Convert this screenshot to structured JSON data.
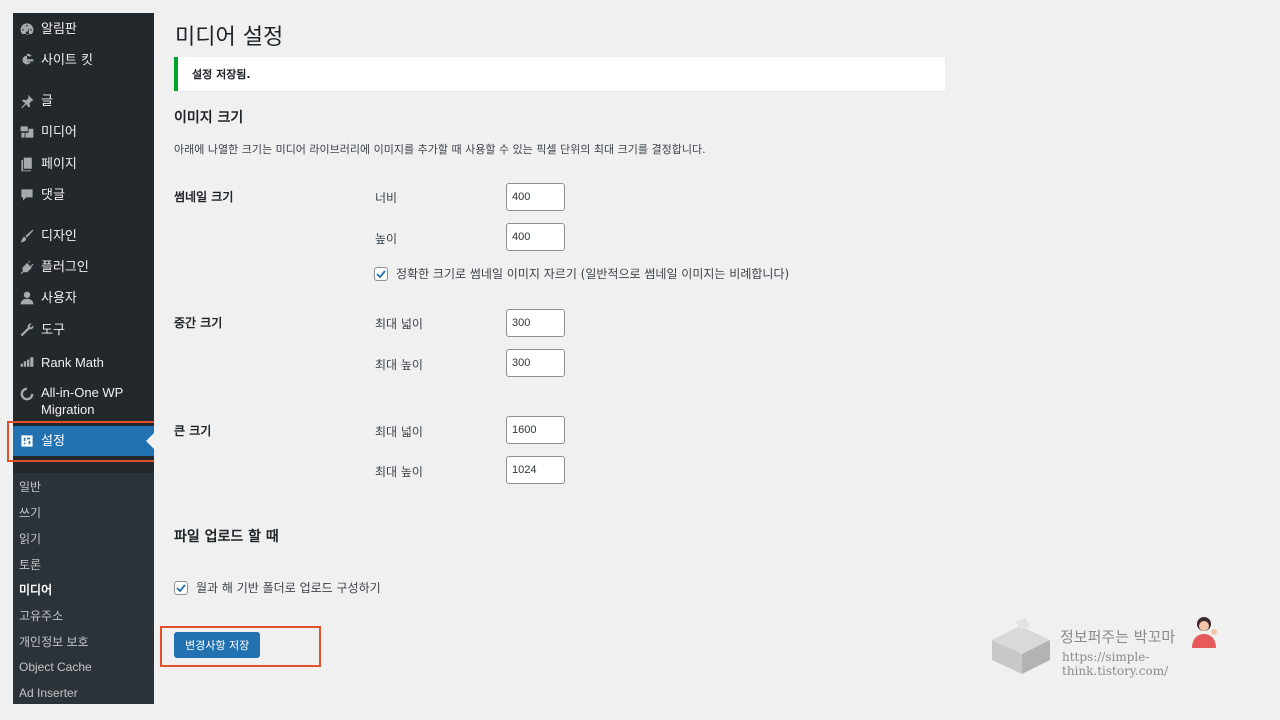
{
  "sidebar": {
    "items": [
      {
        "label": "알림판",
        "icon": "dashboard-icon"
      },
      {
        "label": "사이트 킷",
        "icon": "google-g-icon"
      },
      {
        "label": "글",
        "icon": "pushpin-icon"
      },
      {
        "label": "미디어",
        "icon": "media-icon"
      },
      {
        "label": "페이지",
        "icon": "pages-icon"
      },
      {
        "label": "댓글",
        "icon": "comment-icon"
      },
      {
        "label": "디자인",
        "icon": "brush-icon"
      },
      {
        "label": "플러그인",
        "icon": "plugin-icon"
      },
      {
        "label": "사용자",
        "icon": "user-icon"
      },
      {
        "label": "도구",
        "icon": "wrench-icon"
      },
      {
        "label": "Rank Math",
        "icon": "rankmath-icon"
      },
      {
        "label": "All-in-One WP Migration",
        "icon": "migration-icon"
      },
      {
        "label": "설정",
        "icon": "settings-icon"
      }
    ],
    "submenu": [
      {
        "label": "일반"
      },
      {
        "label": "쓰기"
      },
      {
        "label": "읽기"
      },
      {
        "label": "토론"
      },
      {
        "label": "미디어"
      },
      {
        "label": "고유주소"
      },
      {
        "label": "개인정보 보호"
      },
      {
        "label": "Object Cache"
      },
      {
        "label": "Ad Inserter"
      }
    ]
  },
  "page": {
    "title": "미디어 설정",
    "notice": "설정 저장됨.",
    "image_sizes_heading": "이미지 크기",
    "image_sizes_desc": "아래에 나열한 크기는 미디어 라이브러리에 이미지를 추가할 때 사용할 수 있는 픽셀 단위의 최대 크기를 결정합니다.",
    "thumbnail": {
      "label": "썸네일 크기",
      "width_label": "너비",
      "width_value": "400",
      "height_label": "높이",
      "height_value": "400",
      "crop_label": "정확한 크기로 썸네일 이미지 자르기 (일반적으로 썸네일 이미지는 비례합니다)",
      "crop_checked": true
    },
    "medium": {
      "label": "중간 크기",
      "width_label": "최대 넓이",
      "width_value": "300",
      "height_label": "최대 높이",
      "height_value": "300"
    },
    "large": {
      "label": "큰 크기",
      "width_label": "최대 넓이",
      "width_value": "1600",
      "height_label": "최대 높이",
      "height_value": "1024"
    },
    "uploads_heading": "파일 업로드 할 때",
    "uploads_option_label": "월과 해 기반 폴더로 업로드 구성하기",
    "uploads_option_checked": true,
    "save_label": "변경사항 저장"
  },
  "watermark": {
    "name": "정보퍼주는 박꼬마",
    "url": "https://simple-think.tistory.com/"
  },
  "colors": {
    "sidebar_bg": "#23282d",
    "active_bg": "#2271b1",
    "notice_border": "#00a32a",
    "highlight": "#e0502a"
  }
}
